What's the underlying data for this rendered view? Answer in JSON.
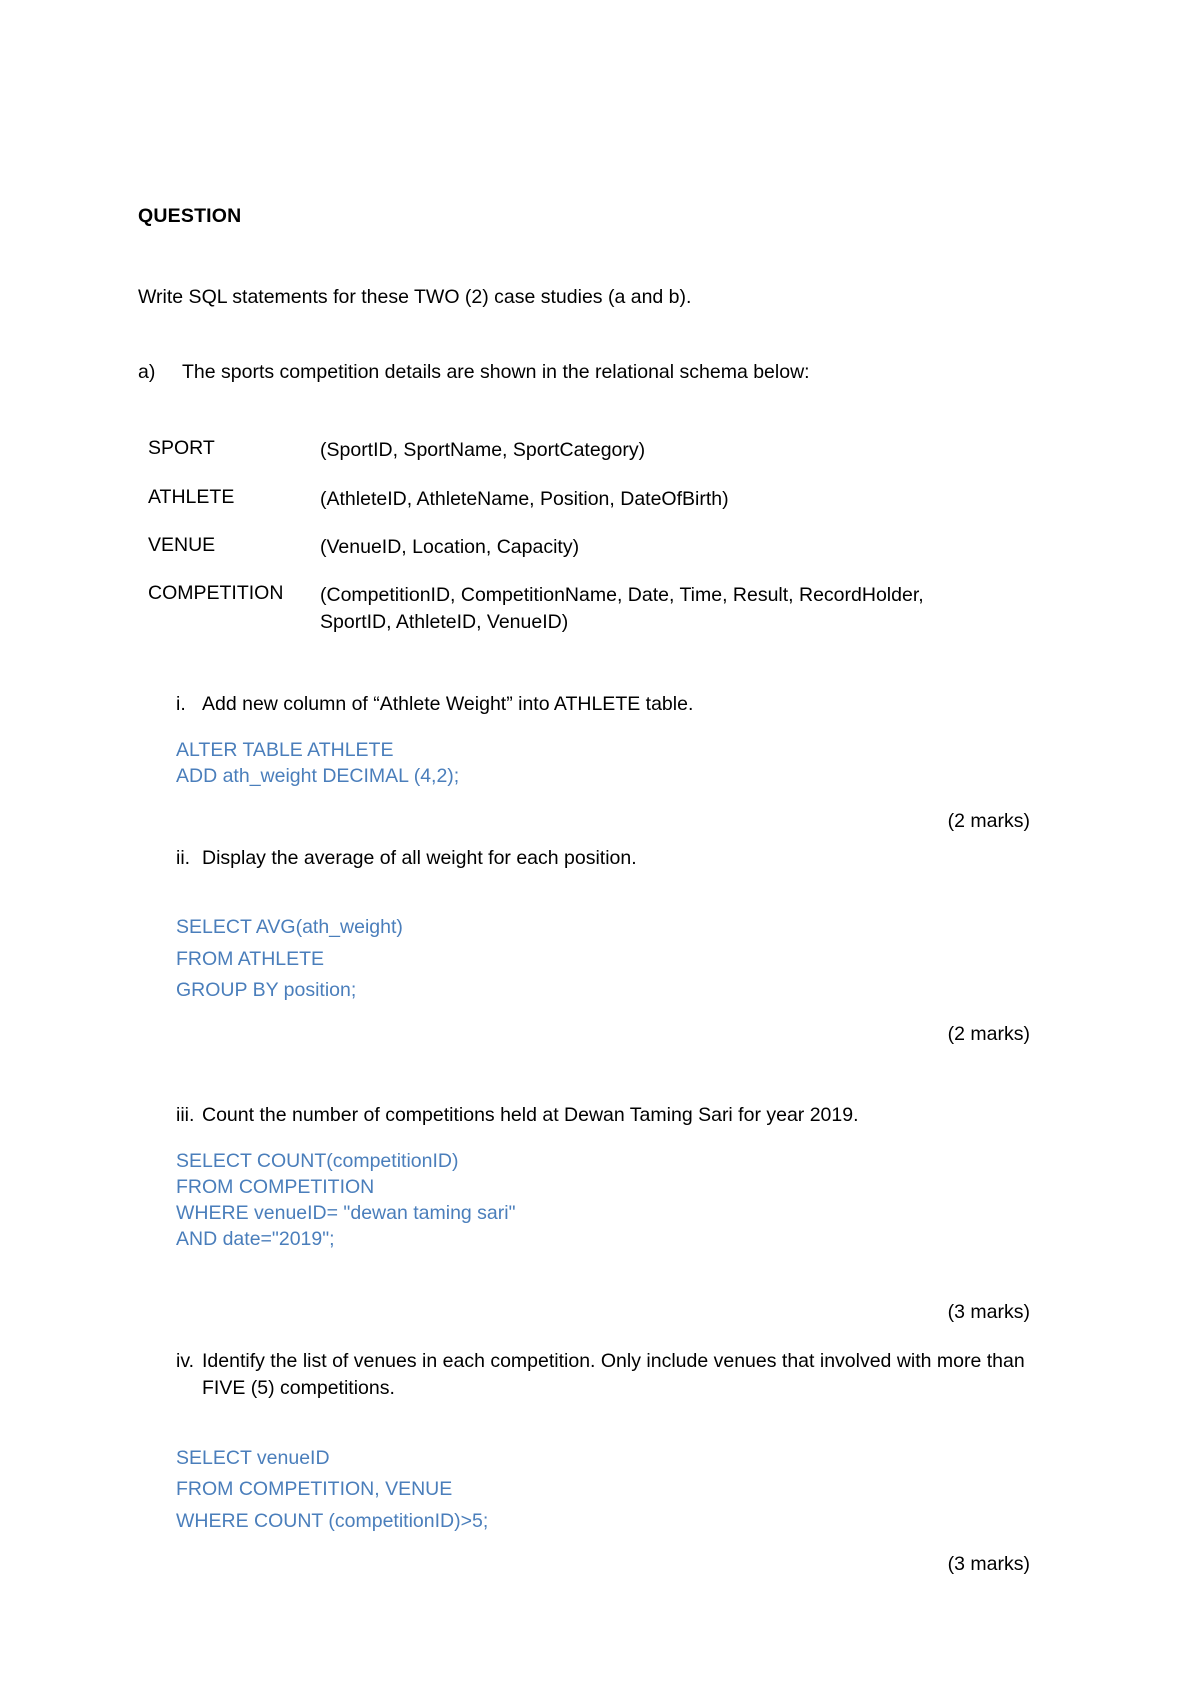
{
  "document": {
    "heading": "QUESTION",
    "intro": "Write SQL statements for these TWO (2) case studies (a and b).",
    "part_a": {
      "marker": "a)",
      "text": "The sports competition details are shown in the relational schema below:"
    },
    "schema": [
      {
        "name": "SPORT",
        "attributes": "(SportID, SportName, SportCategory)"
      },
      {
        "name": "ATHLETE",
        "attributes": "(AthleteID, AthleteName, Position, DateOfBirth)"
      },
      {
        "name": "VENUE",
        "attributes": "(VenueID, Location, Capacity)"
      },
      {
        "name": "COMPETITION",
        "attributes_line1": "(CompetitionID, CompetitionName, Date, Time, Result, RecordHolder,",
        "attributes_line2": "SportID, AthleteID, VenueID)"
      }
    ],
    "items": [
      {
        "marker": "i.",
        "question": "Add new column of “Athlete Weight” into ATHLETE table.",
        "answer": "ALTER TABLE ATHLETE\nADD ath_weight DECIMAL (4,2);",
        "marks": "(2 marks)"
      },
      {
        "marker": "ii.",
        "question": "Display the average of all weight for each position.",
        "answer": "SELECT AVG(ath_weight)\nFROM ATHLETE\nGROUP BY position;",
        "marks": "(2 marks)"
      },
      {
        "marker": "iii.",
        "question": "Count the number of competitions held at Dewan Taming Sari for year 2019.",
        "answer": "SELECT COUNT(competitionID)\nFROM COMPETITION\nWHERE venueID= \"dewan taming sari\"\nAND date=\"2019\";",
        "marks": "(3 marks)"
      },
      {
        "marker": "iv.",
        "question_line1": "Identify the list of venues in each competition. Only include venues that involved with",
        "question_line2": "more than FIVE (5) competitions.",
        "answer": "SELECT venueID\nFROM COMPETITION, VENUE\nWHERE COUNT (competitionID)>5;",
        "marks": "(3 marks)"
      }
    ],
    "colors": {
      "sql_blue": "#4a7ebb",
      "body_black": "#000000",
      "page_background": "#ffffff"
    }
  }
}
